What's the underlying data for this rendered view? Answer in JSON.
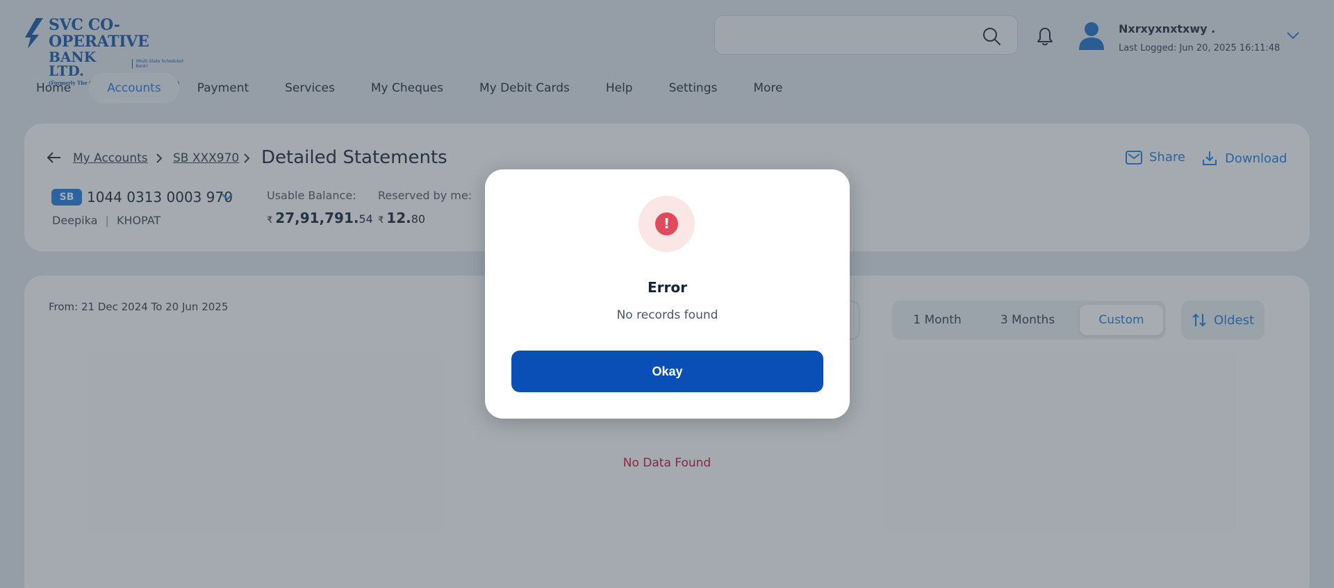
{
  "header": {
    "logo": {
      "line1": "SVC CO-OPERATIVE",
      "line2": "BANK LTD.",
      "sub": "(Multi-State Scheduled Bank)",
      "line3": "(Formerly The Shamrao Vithal Co-op Bank Ltd.)"
    },
    "search": {
      "placeholder": ""
    },
    "user": {
      "name": "Nxrxyxnxtxwy .",
      "last_logged": "Last Logged: Jun 20, 2025 16:11:48"
    }
  },
  "nav": {
    "items": [
      {
        "label": "Home"
      },
      {
        "label": "Accounts",
        "active": true
      },
      {
        "label": "Payment"
      },
      {
        "label": "Services"
      },
      {
        "label": "My Cheques"
      },
      {
        "label": "My Debit Cards"
      },
      {
        "label": "Help"
      },
      {
        "label": "Settings"
      },
      {
        "label": "More"
      }
    ]
  },
  "breadcrumb": {
    "items": [
      {
        "label": "My Accounts"
      },
      {
        "label": "SB XXX970"
      }
    ],
    "current": "Detailed Statements"
  },
  "actions": {
    "share": "Share",
    "download": "Download"
  },
  "account": {
    "type": "SB",
    "number": "1044 0313 0003 970",
    "holder": "Deepika",
    "branch": "KHOPAT",
    "usable_label": "Usable Balance:",
    "usable_currency": "₹",
    "usable_main": "27,91,791.",
    "usable_decimal": "54",
    "reserved_label": "Reserved by me:",
    "reserved_currency": "₹",
    "reserved_main": "12.",
    "reserved_decimal": "80"
  },
  "statement": {
    "range": "From: 21 Dec 2024 To 20 Jun 2025",
    "periods": [
      {
        "label": "1 Month"
      },
      {
        "label": "3 Months"
      },
      {
        "label": "Custom",
        "active": true
      }
    ],
    "sort": "Oldest",
    "empty": "No Data Found"
  },
  "modal": {
    "icon": "!",
    "title": "Error",
    "message": "No records found",
    "button": "Okay"
  },
  "colors": {
    "accent": "#1d7be0",
    "primary_button": "#0a4fb5",
    "error": "#e04a5a",
    "empty_text": "#c8102e"
  }
}
